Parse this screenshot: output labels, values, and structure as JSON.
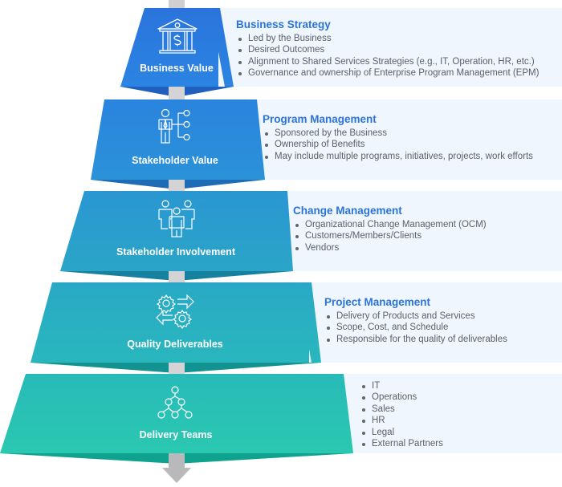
{
  "colors": {
    "heading": "#2b74d8",
    "body_text": "#5a5f6b",
    "panel_bg": "#f0f6fe",
    "spine": "#c9c9cc",
    "arrow": "#b9b9bc",
    "layers": [
      "#2a7fe0",
      "#2a8ad8",
      "#2b9ccd",
      "#29aec2",
      "#2ac3b2"
    ],
    "layer_shadows": [
      "#1f62c0",
      "#1f6fb8",
      "#1a80a8",
      "#19969b",
      "#12a38f"
    ]
  },
  "layers": [
    {
      "label": "Business Value",
      "icon": "bank-dollar-icon",
      "panel": {
        "heading": "Business Strategy",
        "bullets": [
          "Led by the Business",
          "Desired Outcomes",
          "Alignment to Shared Services Strategies (e.g., IT, Operation, HR, etc.)",
          "Governance and ownership of Enterprise Program Management (EPM)"
        ]
      }
    },
    {
      "label": "Stakeholder Value",
      "icon": "person-connections-icon",
      "panel": {
        "heading": "Program Management",
        "bullets": [
          "Sponsored by the Business",
          "Ownership of Benefits",
          "May include multiple programs, initiatives, projects, work efforts"
        ]
      }
    },
    {
      "label": "Stakeholder Involvement",
      "icon": "group-people-icon",
      "panel": {
        "heading": "Change Management",
        "bullets": [
          "Organizational Change Management (OCM)",
          "Customers/Members/Clients",
          "Vendors"
        ]
      }
    },
    {
      "label": "Quality Deliverables",
      "icon": "gears-arrows-icon",
      "panel": {
        "heading": "Project Management",
        "bullets": [
          "Delivery of Products and Services",
          "Scope, Cost, and Schedule",
          "Responsible for the quality of deliverables"
        ]
      }
    },
    {
      "label": "Delivery Teams",
      "icon": "hierarchy-network-icon",
      "panel": {
        "heading": "",
        "bullets": [
          "IT",
          "Operations",
          "Sales",
          "HR",
          "Legal",
          "External Partners"
        ]
      }
    }
  ]
}
